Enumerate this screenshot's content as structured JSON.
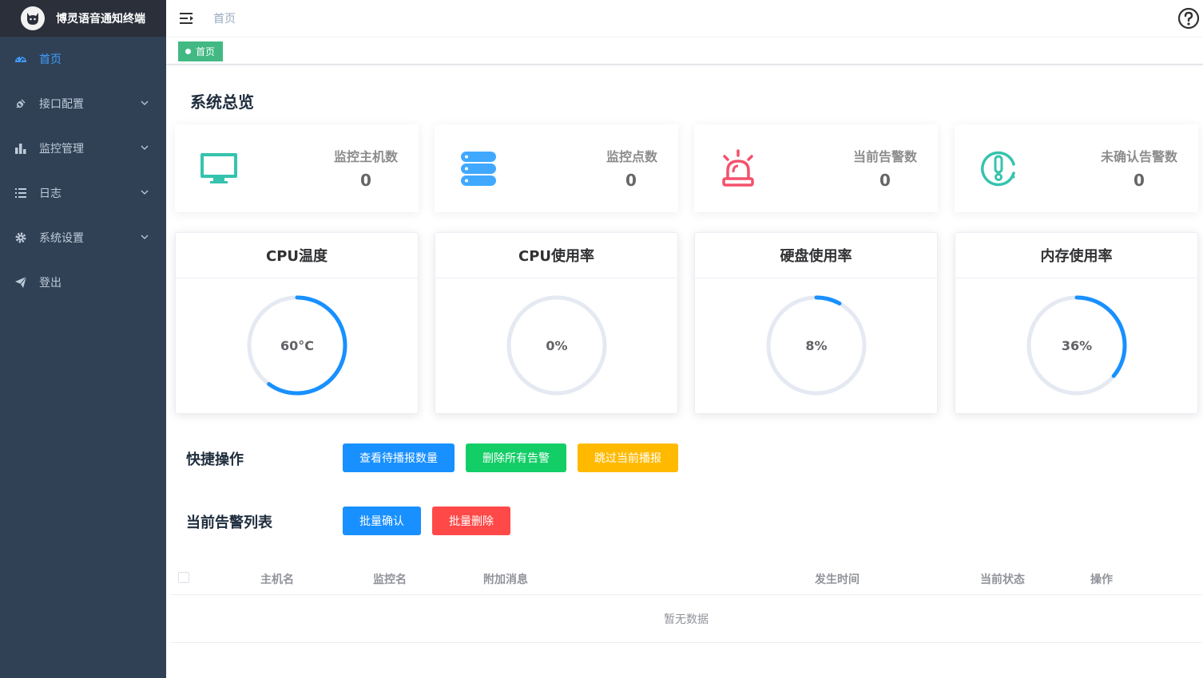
{
  "brand": {
    "title": "博灵语音通知终端"
  },
  "sidebar": {
    "items": [
      {
        "label": "首页",
        "icon": "dashboard-icon",
        "active": true,
        "has_children": false
      },
      {
        "label": "接口配置",
        "icon": "plug-icon",
        "active": false,
        "has_children": true
      },
      {
        "label": "监控管理",
        "icon": "bar-chart-icon",
        "active": false,
        "has_children": true
      },
      {
        "label": "日志",
        "icon": "list-icon",
        "active": false,
        "has_children": true
      },
      {
        "label": "系统设置",
        "icon": "gear-icon",
        "active": false,
        "has_children": true
      },
      {
        "label": "登出",
        "icon": "paper-plane-icon",
        "active": false,
        "has_children": false
      }
    ]
  },
  "navbar": {
    "breadcrumb": "首页"
  },
  "tags": {
    "active": "首页"
  },
  "overview": {
    "title": "系统总览",
    "stats": [
      {
        "label": "监控主机数",
        "value": "0",
        "icon": "monitor-icon",
        "color": "#36c3ae"
      },
      {
        "label": "监控点数",
        "value": "0",
        "icon": "server-stack-icon",
        "color": "#40a9ff"
      },
      {
        "label": "当前告警数",
        "value": "0",
        "icon": "alarm-siren-icon",
        "color": "#f4516c"
      },
      {
        "label": "未确认告警数",
        "value": "0",
        "icon": "exclamation-circle-icon",
        "color": "#36c3ae"
      }
    ]
  },
  "gauges": [
    {
      "title": "CPU温度",
      "text": "60°C",
      "percent": 60
    },
    {
      "title": "CPU使用率",
      "text": "0%",
      "percent": 0
    },
    {
      "title": "硬盘使用率",
      "text": "8%",
      "percent": 8
    },
    {
      "title": "内存使用率",
      "text": "36%",
      "percent": 36
    }
  ],
  "quick_actions": {
    "title": "快捷操作",
    "buttons": [
      "查看待播报数量",
      "删除所有告警",
      "跳过当前播报"
    ]
  },
  "alarm_list": {
    "title": "当前告警列表",
    "buttons": [
      "批量确认",
      "批量删除"
    ],
    "columns": [
      "主机名",
      "监控名",
      "附加消息",
      "发生时间",
      "当前状态",
      "操作"
    ],
    "empty_text": "暂无数据"
  },
  "colors": {
    "sidebar_bg": "#304156",
    "accent": "#409eff",
    "tag_green": "#42b983",
    "gauge_arc": "#1890ff",
    "gauge_track": "#e5e9f2"
  }
}
